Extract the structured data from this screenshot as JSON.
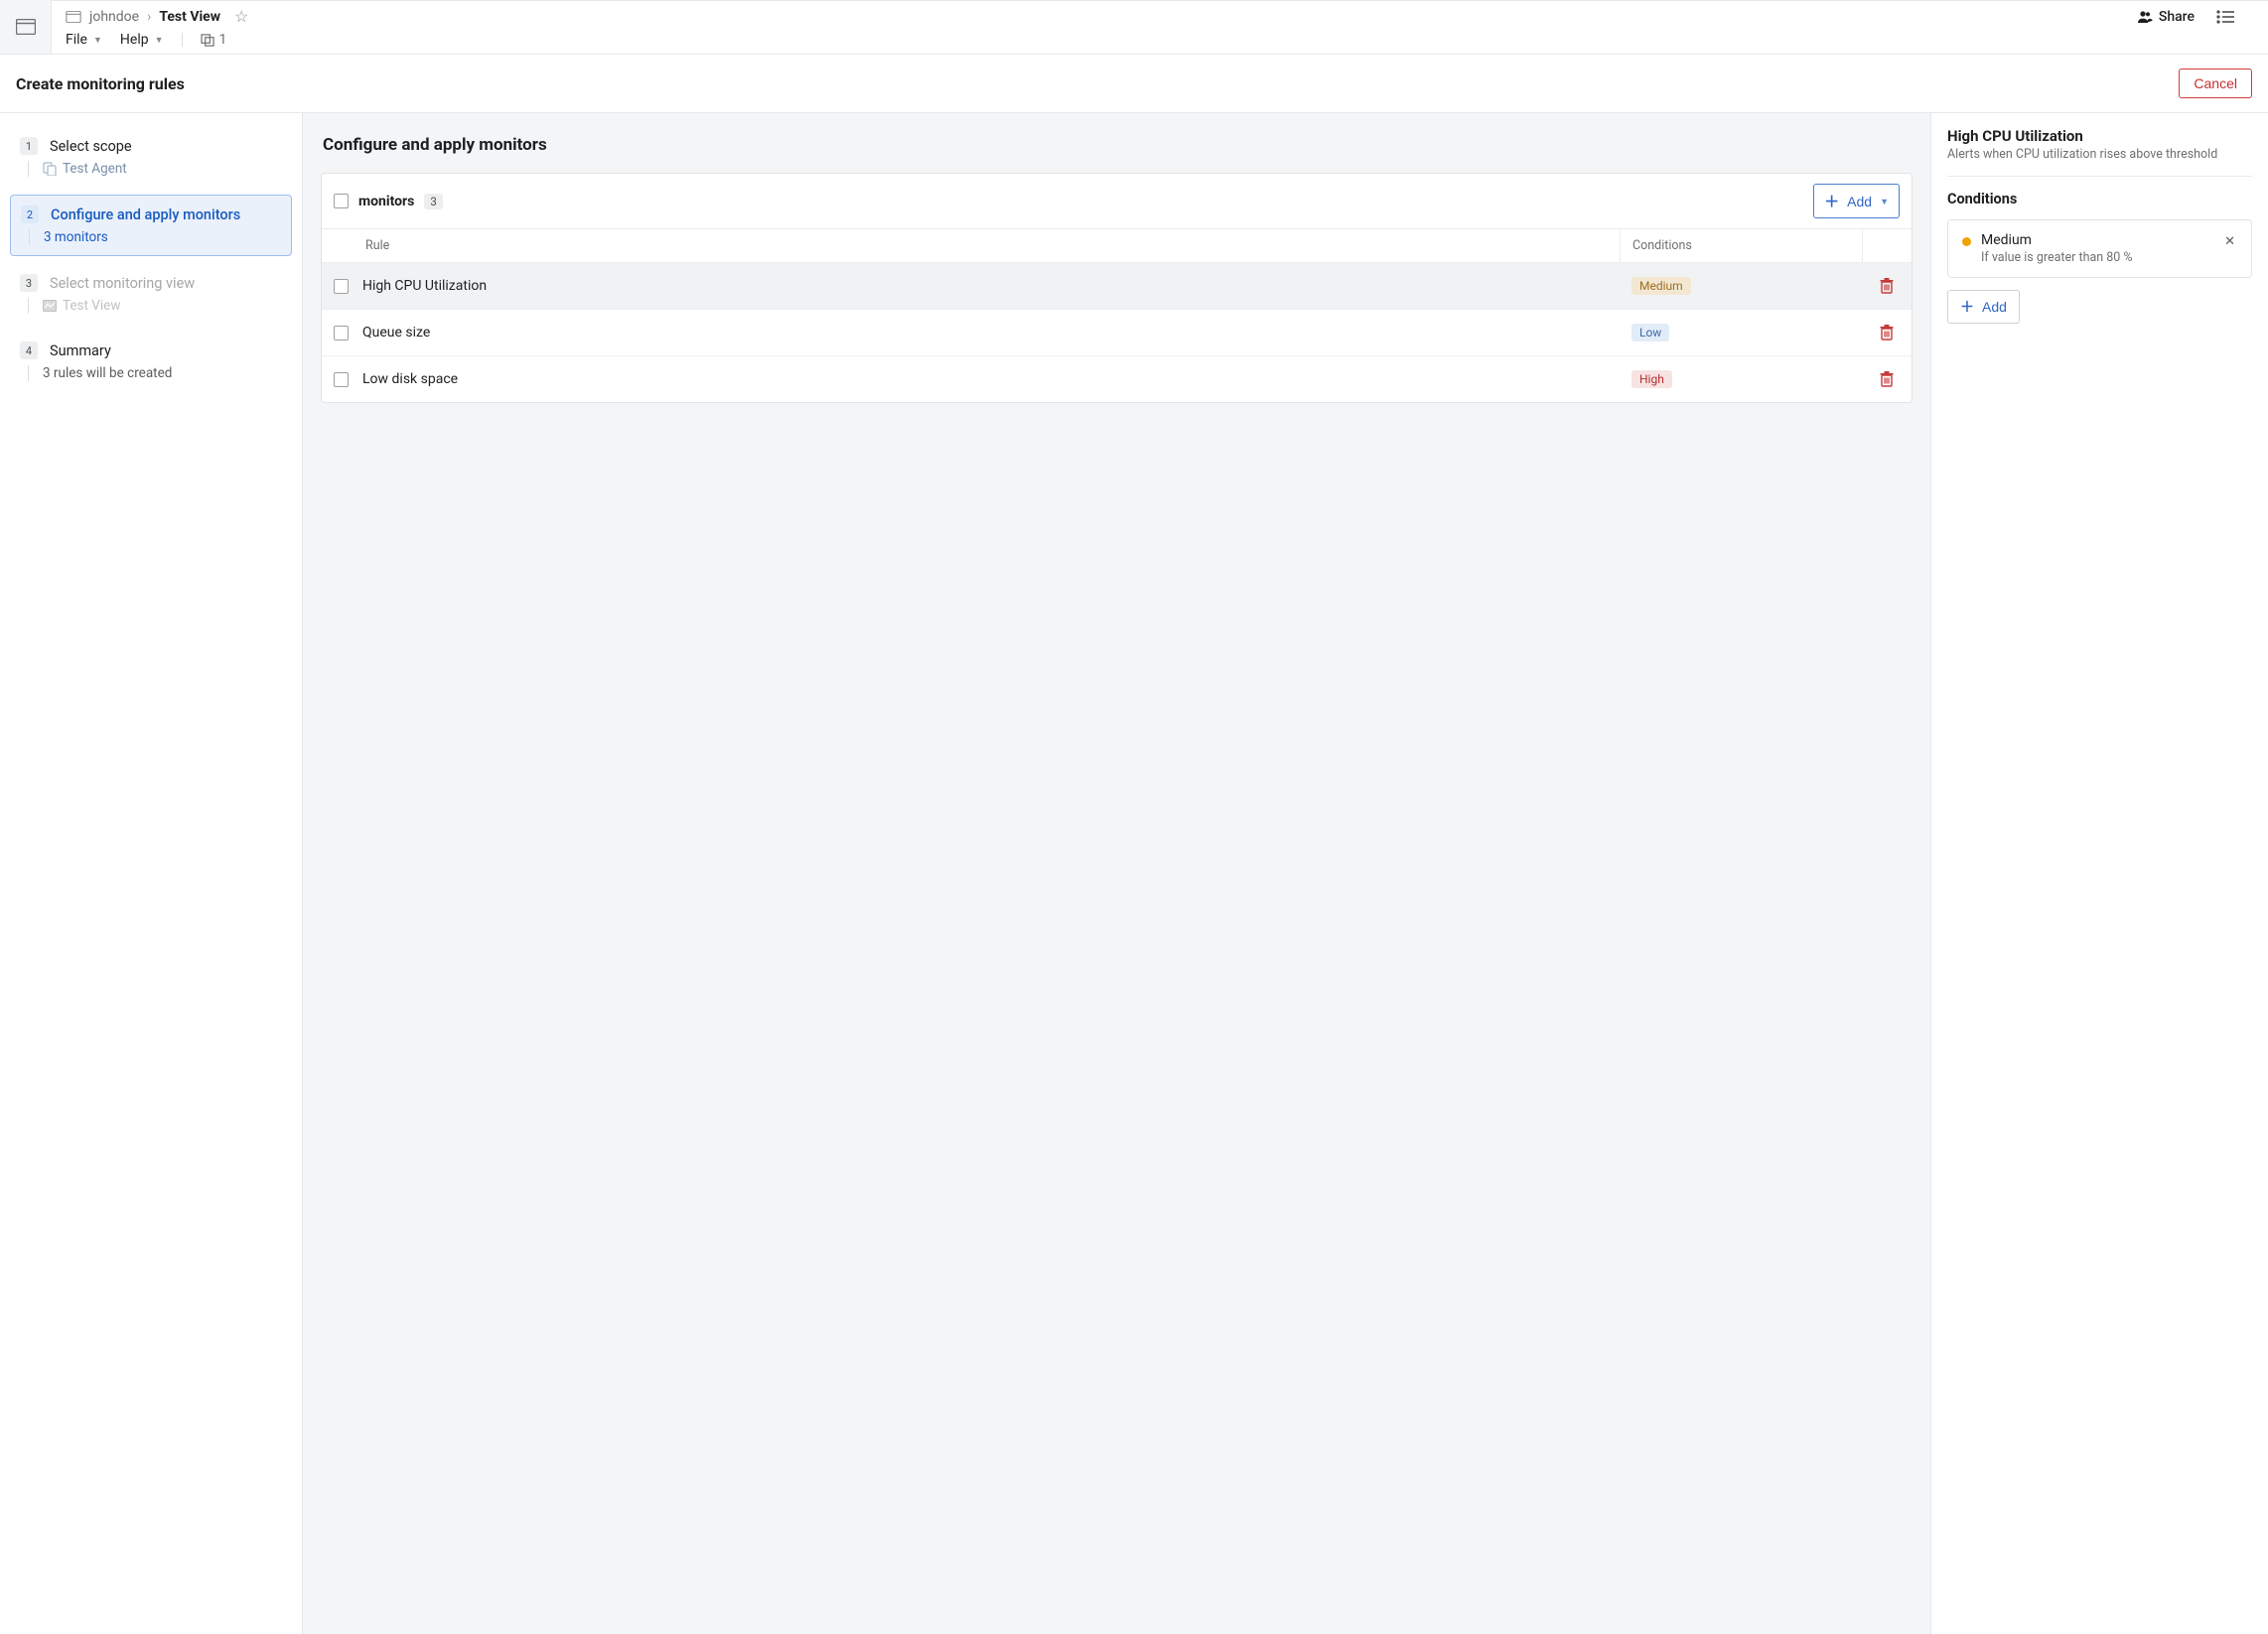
{
  "header": {
    "breadcrumb_owner": "johndoe",
    "breadcrumb_view": "Test View",
    "menu_file": "File",
    "menu_help": "Help",
    "viewers": "1",
    "share": "Share"
  },
  "subheader": {
    "title": "Create monitoring rules",
    "cancel": "Cancel"
  },
  "sidebar": {
    "steps": [
      {
        "num": "1",
        "title": "Select scope",
        "sub": "Test Agent"
      },
      {
        "num": "2",
        "title": "Configure and apply monitors",
        "sub": "3 monitors"
      },
      {
        "num": "3",
        "title": "Select monitoring view",
        "sub": "Test View"
      },
      {
        "num": "4",
        "title": "Summary",
        "sub": "3 rules will be created"
      }
    ]
  },
  "center": {
    "title": "Configure and apply monitors",
    "table": {
      "heading": "monitors",
      "count": "3",
      "add": "Add",
      "col_rule": "Rule",
      "col_cond": "Conditions",
      "rows": [
        {
          "rule": "High CPU Utilization",
          "cond": "Medium",
          "cond_class": "medium"
        },
        {
          "rule": "Queue size",
          "cond": "Low",
          "cond_class": "low"
        },
        {
          "rule": "Low disk space",
          "cond": "High",
          "cond_class": "high"
        }
      ]
    }
  },
  "detail": {
    "title": "High CPU Utilization",
    "desc": "Alerts when CPU utilization rises above threshold",
    "section": "Conditions",
    "cond_label": "Medium",
    "cond_rule": "If value is greater than 80 %",
    "add": "Add"
  }
}
